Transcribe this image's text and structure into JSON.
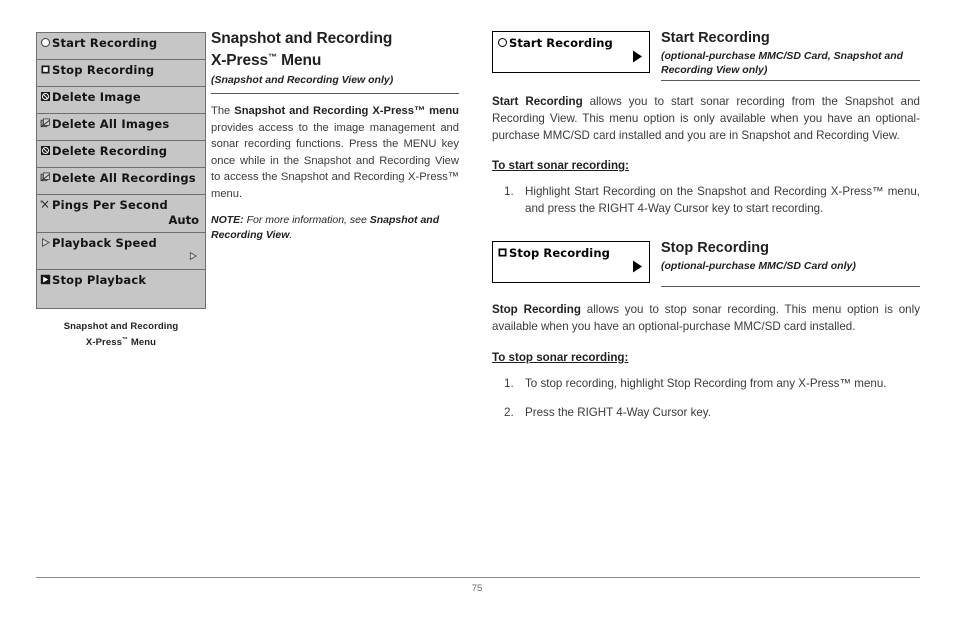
{
  "document": {
    "page_number": "75"
  },
  "lcd_menu": {
    "caption_line1": "Snapshot and Recording",
    "caption_line2_pre": "X-Press",
    "caption_line2_tm": "™",
    "caption_line2_post": " Menu",
    "rows": [
      {
        "label": "Start Recording",
        "icon": "circle-icon",
        "value": ""
      },
      {
        "label": "Stop Recording",
        "icon": "filled-square-icon",
        "value": ""
      },
      {
        "label": "Delete Image",
        "icon": "crossed-circle-icon",
        "value": ""
      },
      {
        "label": "Delete All Images",
        "icon": "stacked-pages-icon",
        "value": ""
      },
      {
        "label": "Delete Recording",
        "icon": "crossed-circle-icon",
        "value": ""
      },
      {
        "label": "Delete All Recordings",
        "icon": "stacked-pages-icon",
        "value": ""
      },
      {
        "label": "Pings Per Second",
        "icon": "pings-icon",
        "value": "Auto"
      },
      {
        "label": "Playback Speed",
        "icon": "outline-triangle-icon",
        "value": ""
      },
      {
        "label": "Stop Playback",
        "icon": "stop-playback-icon",
        "value": ""
      }
    ]
  },
  "left_column": {
    "title_line1": "Snapshot and Recording",
    "title_line2_pre": "X-Press",
    "title_tm": "™",
    "title_line2_post": " Menu",
    "subtitle": "(Snapshot and Recording View only)",
    "paragraph_1_pre": "The ",
    "paragraph_1_bold": "Snapshot and Recording X-Press™ menu",
    "paragraph_1_post": " provides access to the image management and sonar recording functions. Press the MENU key once while in the Snapshot and Recording View to access the Snapshot and Recording X-Press™ menu.",
    "note_label": "NOTE:",
    "note_text_pre": " For more information, see ",
    "note_text_bold": "Snapshot and Recording View",
    "note_text_post": "."
  },
  "right_column": {
    "start_recording": {
      "chip_label": "Start Recording",
      "chip_icon": "circle-icon",
      "chip_arrow_icon": "right-arrow-icon",
      "title": "Start Recording",
      "subtitle": "(optional-purchase MMC/SD Card, Snapshot and Recording View only)",
      "body_bold": "Start Recording",
      "body_text": " allows you to start sonar recording from the Snapshot and Recording View. This menu option is only available when you have an optional-purchase MMC/SD card installed and you are in Snapshot and Recording View.",
      "howto_heading": "To start sonar recording:",
      "steps": [
        "Highlight Start Recording on the Snapshot and Recording X-Press™ menu, and press the RIGHT 4-Way Cursor key to start recording."
      ]
    },
    "stop_recording": {
      "chip_label": "Stop Recording",
      "chip_icon": "filled-square-icon",
      "chip_arrow_icon": "right-arrow-icon",
      "title": "Stop Recording",
      "subtitle": "(optional-purchase MMC/SD Card only)",
      "body_bold": "Stop Recording",
      "body_text": " allows you to stop sonar recording. This menu option is only available when you have an optional-purchase MMC/SD card installed.",
      "howto_heading": "To stop sonar recording:",
      "steps": [
        "To stop recording, highlight Stop Recording from any X-Press™ menu.",
        "Press the RIGHT 4-Way Cursor key."
      ]
    }
  },
  "colors": {
    "lcd_background": "#c6c6c6",
    "lcd_border": "#6e6e6e",
    "text_primary": "#231f20",
    "text_body": "#3b3b3d",
    "rule": "#58585a"
  }
}
